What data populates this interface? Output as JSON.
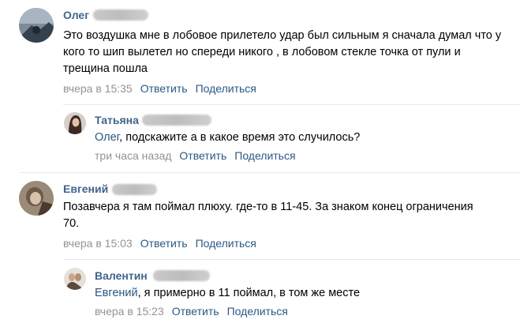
{
  "comments": [
    {
      "author": "Олег",
      "text": "Это воздушка мне в лобовое прилетело удар был сильным я сначала думал что у кого то шип вылетел но спереди никого , в лобовом стекле точка от пули и трещина пошла",
      "time": "вчера в 15:35",
      "reply": "Ответить",
      "share": "Поделиться"
    },
    {
      "author": "Татьяна",
      "addressee": "Олег",
      "text": ", подскажите а в какое время это случилось?",
      "time": "три часа назад",
      "reply": "Ответить",
      "share": "Поделиться"
    },
    {
      "author": "Евгений",
      "text": "Позавчера я там поймал плюху. где-то в 11-45. За знаком конец ограничения 70.",
      "time": "вчера в 15:03",
      "reply": "Ответить",
      "share": "Поделиться"
    },
    {
      "author": "Валентин",
      "addressee": "Евгений",
      "text": ", я примерно в 11 поймал, в том же месте",
      "time": "вчера в 15:23",
      "reply": "Ответить",
      "share": "Поделиться"
    }
  ],
  "colors": {
    "author": "#42648b",
    "link": "#2a5885",
    "meta": "#939393",
    "separator": "#e7e8ec"
  }
}
